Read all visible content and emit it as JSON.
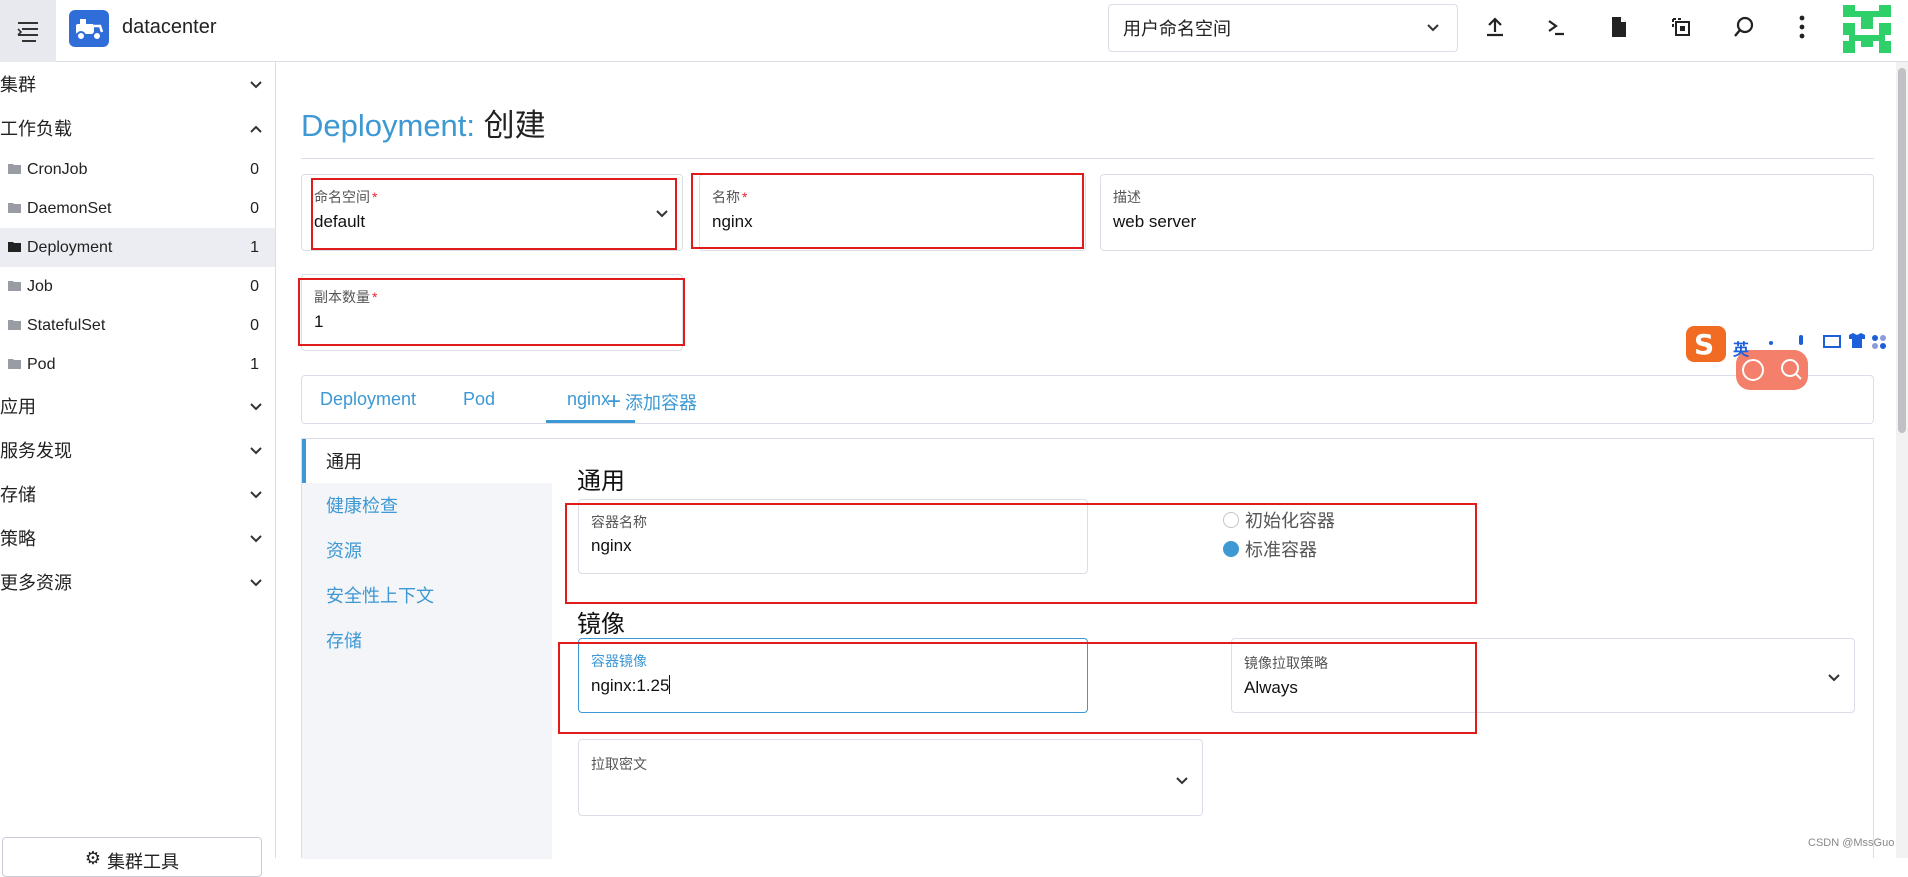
{
  "topbar": {
    "app_title": "datacenter",
    "namespace_select": "用户命名空间",
    "icons": [
      "menu-icon",
      "upload-icon",
      "terminal-icon",
      "file-icon",
      "copy-icon",
      "search-icon",
      "more-vertical-icon"
    ]
  },
  "sidebar": {
    "groups": [
      {
        "label": "集群",
        "expanded": false
      },
      {
        "label": "工作负载",
        "expanded": true
      },
      {
        "label": "应用",
        "expanded": false
      },
      {
        "label": "服务发现",
        "expanded": false
      },
      {
        "label": "存储",
        "expanded": false
      },
      {
        "label": "策略",
        "expanded": false
      },
      {
        "label": "更多资源",
        "expanded": false
      }
    ],
    "workload_items": [
      {
        "label": "CronJob",
        "count": "0"
      },
      {
        "label": "DaemonSet",
        "count": "0"
      },
      {
        "label": "Deployment",
        "count": "1",
        "active": true
      },
      {
        "label": "Job",
        "count": "0"
      },
      {
        "label": "StatefulSet",
        "count": "0"
      },
      {
        "label": "Pod",
        "count": "1"
      }
    ],
    "cluster_tools": "集群工具"
  },
  "page": {
    "title_kind": "Deployment:",
    "title_action": "创建"
  },
  "form": {
    "namespace": {
      "label": "命名空间",
      "value": "default"
    },
    "name": {
      "label": "名称",
      "value": "nginx"
    },
    "description": {
      "label": "描述",
      "value": "web server"
    },
    "replicas": {
      "label": "副本数量",
      "value": "1"
    }
  },
  "tabs": [
    "Deployment",
    "Pod",
    "nginx",
    "添加容器"
  ],
  "subnav": [
    "通用",
    "健康检查",
    "资源",
    "安全性上下文",
    "存储"
  ],
  "container": {
    "section_general": "通用",
    "name_label": "容器名称",
    "name_value": "nginx",
    "radio_init": "初始化容器",
    "radio_standard": "标准容器",
    "section_image": "镜像",
    "image_label": "容器镜像",
    "image_value": "nginx:1.25",
    "pull_policy_label": "镜像拉取策略",
    "pull_policy_value": "Always",
    "pull_secret_label": "拉取密文"
  },
  "ime": {
    "lang": "英"
  },
  "watermark": "CSDN @MssGuo",
  "colors": {
    "accent": "#3d98d3",
    "highlight": "#e01b1b",
    "required": "#ee2233"
  }
}
